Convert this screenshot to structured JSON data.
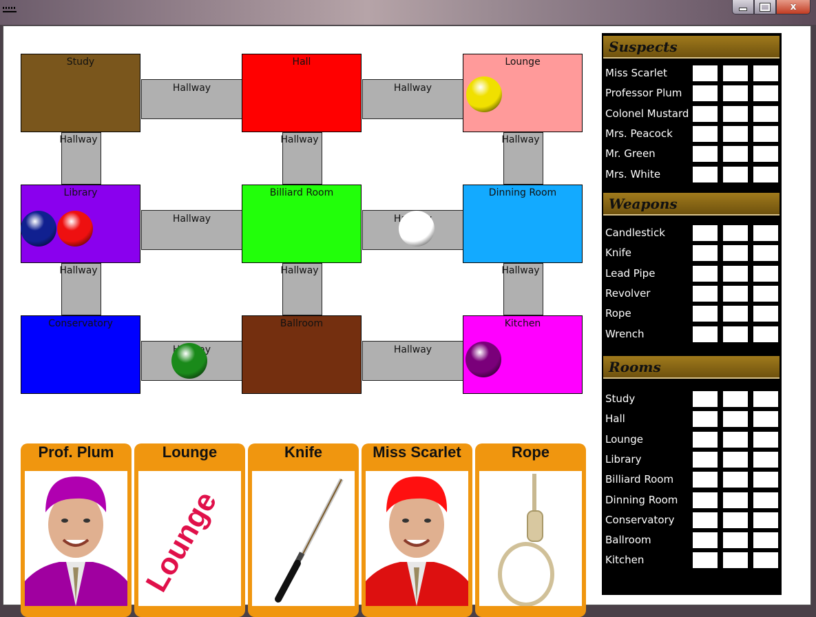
{
  "window": {
    "minimize_label": "",
    "maximize_label": "",
    "close_label": "x"
  },
  "board": {
    "rooms": [
      {
        "name": "Study",
        "color": "#7a561c"
      },
      {
        "name": "Hall",
        "color": "#ff0000"
      },
      {
        "name": "Lounge",
        "color": "#ff9a9a"
      },
      {
        "name": "Library",
        "color": "#8a00ee"
      },
      {
        "name": "Billiard Room",
        "color": "#22ff0a"
      },
      {
        "name": "Dinning Room",
        "color": "#13aaff"
      },
      {
        "name": "Conservatory",
        "color": "#0000ff"
      },
      {
        "name": "Ballroom",
        "color": "#742f0f"
      },
      {
        "name": "Kitchen",
        "color": "#ff00ff"
      }
    ],
    "hallway_label": "Hallway",
    "tokens": [
      {
        "piece": "Colonel Mustard",
        "color": "#f0e000",
        "location": "Lounge"
      },
      {
        "piece": "Mrs. Peacock",
        "color": "#102090",
        "location": "Library"
      },
      {
        "piece": "Miss Scarlet",
        "color": "#ee1010",
        "location": "Library"
      },
      {
        "piece": "Mrs. White",
        "color": "#ffffff",
        "location": "Hallway"
      },
      {
        "piece": "Mr. Green",
        "color": "#1a8a1a",
        "location": "Hallway"
      },
      {
        "piece": "Professor Plum",
        "color": "#7a007a",
        "location": "Kitchen"
      }
    ]
  },
  "cards": [
    {
      "title": "Prof. Plum",
      "image": "person-portrait"
    },
    {
      "title": "Lounge",
      "image": "room-word",
      "word": "Lounge"
    },
    {
      "title": "Knife",
      "image": "knife-sword"
    },
    {
      "title": "Miss Scarlet",
      "image": "person-portrait"
    },
    {
      "title": "Rope",
      "image": "rope-noose"
    }
  ],
  "notes": {
    "suspects": {
      "heading": "Suspects",
      "items": [
        "Miss Scarlet",
        "Professor Plum",
        "Colonel Mustard",
        "Mrs. Peacock",
        "Mr. Green",
        "Mrs. White"
      ]
    },
    "weapons": {
      "heading": "Weapons",
      "items": [
        "Candlestick",
        "Knife",
        "Lead Pipe",
        "Revolver",
        "Rope",
        "Wrench"
      ]
    },
    "rooms": {
      "heading": "Rooms",
      "items": [
        "Study",
        "Hall",
        "Lounge",
        "Library",
        "Billiard Room",
        "Dinning Room",
        "Conservatory",
        "Ballroom",
        "Kitchen"
      ]
    }
  },
  "colors": {
    "card_orange": "#f0960f",
    "hallway_gray": "#b0b0b0",
    "panel_bg": "#000000",
    "section_head": "#8c6a14"
  }
}
